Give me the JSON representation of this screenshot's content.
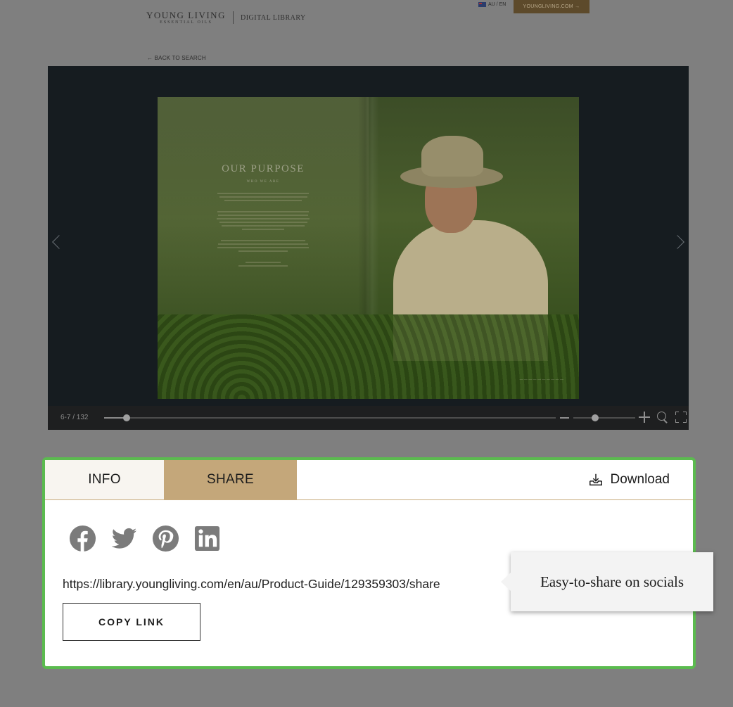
{
  "header": {
    "logo_line1": "YOUNG LIVING",
    "logo_line2": "ESSENTIAL OILS",
    "section": "DIGITAL LIBRARY",
    "locale": "AU / EN",
    "site_link": "YOUNGLIVING.COM →",
    "back": "← BACK TO SEARCH"
  },
  "viewer": {
    "heading": "OUR PURPOSE",
    "subheading": "WHO WE ARE",
    "page_indicator": "6-7 / 132",
    "progress": 0.05,
    "zoom_level": 0.35
  },
  "panel": {
    "tab_info": "INFO",
    "tab_share": "SHARE",
    "active_tab": "SHARE",
    "download_label": "Download",
    "socials": [
      "facebook",
      "twitter",
      "pinterest",
      "linkedin"
    ],
    "share_url": "https://library.youngliving.com/en/au/Product-Guide/129359303/share",
    "copy_label": "COPY LINK"
  },
  "callout": {
    "text": "Easy-to-share on socials"
  },
  "colors": {
    "accent_green": "#5bbb4f",
    "share_tab": "#c4a77a",
    "icon_gray": "#7b7b7b"
  }
}
